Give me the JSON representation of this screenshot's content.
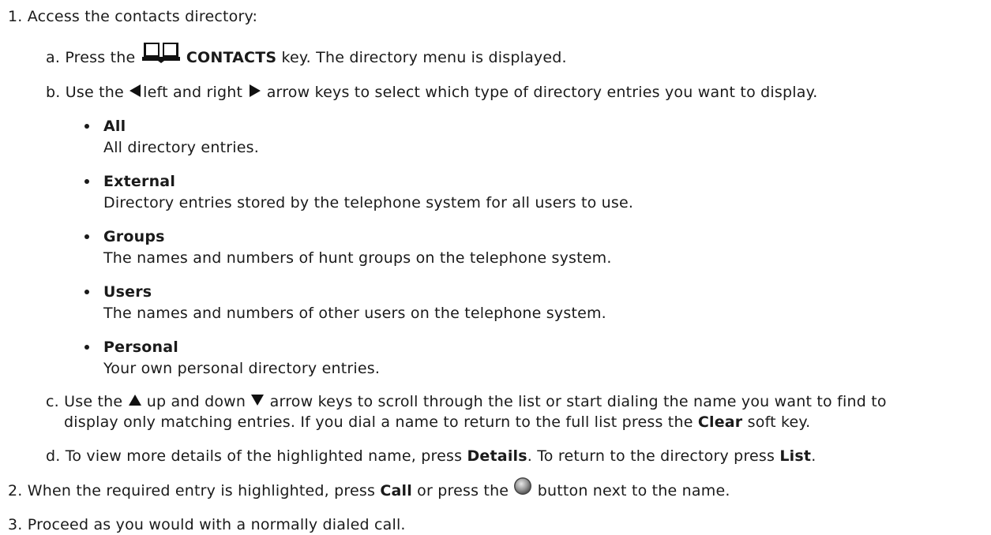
{
  "steps": {
    "s1": {
      "num": "1.",
      "text": "Access the contacts directory:"
    },
    "a": {
      "num": "a.",
      "pre": "Press the",
      "key": "CONTACTS",
      "post": "key. The directory menu is displayed."
    },
    "b": {
      "num": "b.",
      "pre": "Use the",
      "mid": "left and right",
      "post": "arrow keys to select which type of directory entries you want to display."
    },
    "options": [
      {
        "title": "All",
        "desc": "All directory entries."
      },
      {
        "title": "External",
        "desc": "Directory entries stored by the telephone system for all users to use."
      },
      {
        "title": "Groups",
        "desc": "The names and numbers of hunt groups on the telephone system."
      },
      {
        "title": "Users",
        "desc": "The names and numbers of other users on the telephone system."
      },
      {
        "title": "Personal",
        "desc": "Your own personal directory entries."
      }
    ],
    "c": {
      "num": "c.",
      "pre": "Use the",
      "mid": "up and down",
      "post": "arrow keys to scroll through the list or start dialing the name you want to find to",
      "line2_pre": "display only matching entries. If you dial a name to return to the full list press the",
      "line2_key": "Clear",
      "line2_post": "soft key."
    },
    "d": {
      "num": "d.",
      "pre": "To view more details of the highlighted name, press",
      "key1": "Details",
      "mid": ". To return to the directory press",
      "key2": "List",
      "post": "."
    },
    "s2": {
      "num": "2.",
      "pre": "When the required entry is highlighted, press",
      "key": "Call",
      "mid": "or press the",
      "post": "button next to the name."
    },
    "s3": {
      "num": "3.",
      "text": "Proceed as you would with a normally dialed call."
    }
  },
  "icons": {
    "contacts": "book-icon",
    "left": "arrow-left-icon",
    "right": "arrow-right-icon",
    "up": "arrow-up-icon",
    "down": "arrow-down-icon",
    "button": "round-button-icon"
  }
}
